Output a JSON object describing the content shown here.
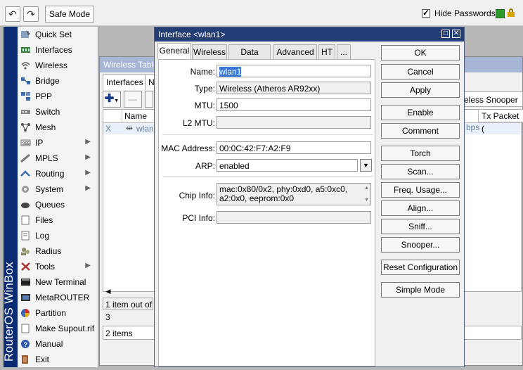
{
  "toolbar": {
    "undo_glyph": "↶",
    "redo_glyph": "↷",
    "safe_mode": "Safe Mode",
    "hide_passwords": "Hide Passwords"
  },
  "brand": {
    "text": "RouterOS WinBox"
  },
  "menu": {
    "items": [
      {
        "label": "Quick Set",
        "icon": "quick-set-icon"
      },
      {
        "label": "Interfaces",
        "icon": "interfaces-icon"
      },
      {
        "label": "Wireless",
        "icon": "wireless-icon"
      },
      {
        "label": "Bridge",
        "icon": "bridge-icon"
      },
      {
        "label": "PPP",
        "icon": "ppp-icon"
      },
      {
        "label": "Switch",
        "icon": "switch-icon"
      },
      {
        "label": "Mesh",
        "icon": "mesh-icon"
      },
      {
        "label": "IP",
        "icon": "ip-icon",
        "submenu": true
      },
      {
        "label": "MPLS",
        "icon": "mpls-icon",
        "submenu": true
      },
      {
        "label": "Routing",
        "icon": "routing-icon",
        "submenu": true
      },
      {
        "label": "System",
        "icon": "system-icon",
        "submenu": true
      },
      {
        "label": "Queues",
        "icon": "queues-icon"
      },
      {
        "label": "Files",
        "icon": "files-icon"
      },
      {
        "label": "Log",
        "icon": "log-icon"
      },
      {
        "label": "Radius",
        "icon": "radius-icon"
      },
      {
        "label": "Tools",
        "icon": "tools-icon",
        "submenu": true
      },
      {
        "label": "New Terminal",
        "icon": "terminal-icon"
      },
      {
        "label": "MetaROUTER",
        "icon": "metarouter-icon"
      },
      {
        "label": "Partition",
        "icon": "partition-icon"
      },
      {
        "label": "Make Supout.rif",
        "icon": "supout-icon"
      },
      {
        "label": "Manual",
        "icon": "manual-icon"
      },
      {
        "label": "Exit",
        "icon": "exit-icon"
      }
    ]
  },
  "wireless_tables": {
    "title": "Wireless Tables",
    "tab_interfaces": "Interfaces",
    "tab_n": "N",
    "col_name": "Name",
    "row_flag": "X",
    "row_name": "wlan1",
    "status_count": "1 item out of 3",
    "status_items": "2 items",
    "right_tab": "eless Snooper",
    "right_col": "Tx Packet (",
    "right_bps": "bps"
  },
  "dialog": {
    "title": "Interface <wlan1>",
    "tabs": [
      "General",
      "Wireless",
      "Data Rates",
      "Advanced",
      "HT",
      "..."
    ],
    "fields": {
      "name_label": "Name:",
      "name_value": "wlan1",
      "type_label": "Type:",
      "type_value": "Wireless (Atheros AR92xx)",
      "mtu_label": "MTU:",
      "mtu_value": "1500",
      "l2mtu_label": "L2 MTU:",
      "l2mtu_value": "",
      "mac_label": "MAC Address:",
      "mac_value": "00:0C:42:F7:A2:F9",
      "arp_label": "ARP:",
      "arp_value": "enabled",
      "chip_label": "Chip Info:",
      "chip_value_1": "mac:0x80/0x2, phy:0xd0, a5:0xc0,",
      "chip_value_2": "a2:0x0, eeprom:0x0",
      "pci_label": "PCI Info:",
      "pci_value": ""
    },
    "buttons": [
      "OK",
      "Cancel",
      "Apply",
      "Enable",
      "Comment",
      "Torch",
      "Scan...",
      "Freq. Usage...",
      "Align...",
      "Sniff...",
      "Snooper...",
      "Reset Configuration",
      "Simple Mode"
    ]
  }
}
